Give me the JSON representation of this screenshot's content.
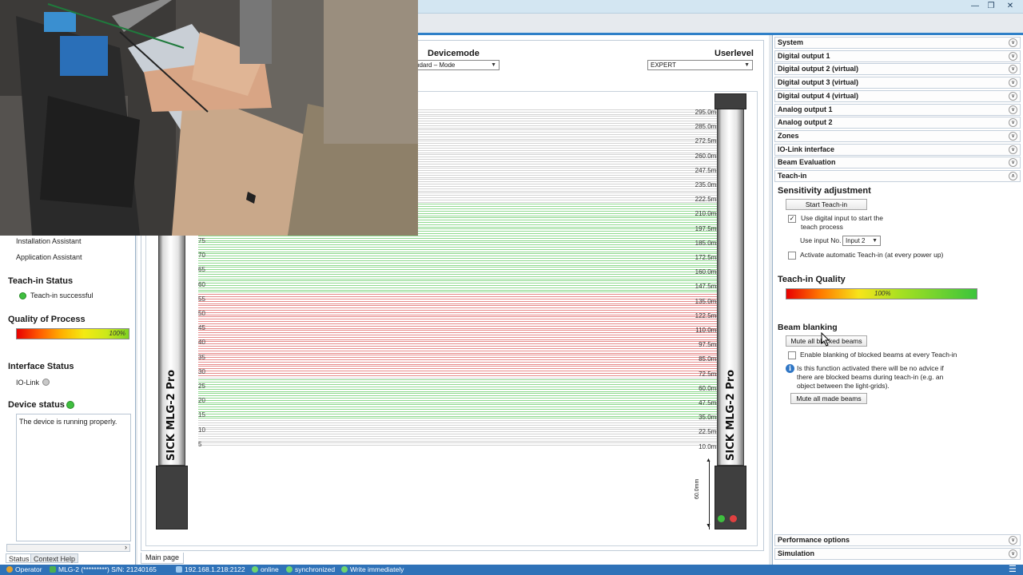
{
  "window": {
    "min_icon": "minimize-icon",
    "max_icon": "restore-icon",
    "close_icon": "close-icon"
  },
  "left_panel": {
    "links": [
      "Installation Assistant",
      "Application Assistant"
    ],
    "teachin_status": {
      "title": "Teach-in Status",
      "value": "Teach-in successful",
      "color": "#3fbf3f"
    },
    "quality": {
      "title": "Quality of Process",
      "value": "100%"
    },
    "interface": {
      "title": "Interface Status",
      "iolink_label": "IO-Link",
      "color": "#c8c8c8"
    },
    "device_status": {
      "title": "Device status",
      "message": "The device is running properly.",
      "color": "#3fbf3f"
    },
    "tabs": [
      "Status",
      "Context Help"
    ]
  },
  "center": {
    "devicemode": {
      "label": "Devicemode",
      "value": "Standard – Mode"
    },
    "userlevel": {
      "label": "Userlevel",
      "value": "EXPERT"
    },
    "brand_left": "SICK MLG-2 Pro",
    "brand_right": "SICK MLG-2 Pro",
    "dimension_label": "60.0mm",
    "beam_numbers": [
      "75",
      "70",
      "65",
      "60",
      "55",
      "50",
      "45",
      "40",
      "35",
      "30",
      "25",
      "20",
      "15",
      "10",
      "5"
    ],
    "mm_labels": [
      "295.0mm",
      "285.0mm",
      "272.5mm",
      "260.0mm",
      "247.5mm",
      "235.0mm",
      "222.5mm",
      "210.0mm",
      "197.5mm",
      "185.0mm",
      "172.5mm",
      "160.0mm",
      "147.5mm",
      "135.0mm",
      "122.5mm",
      "110.0mm",
      "97.5mm",
      "85.0mm",
      "72.5mm",
      "60.0mm",
      "47.5mm",
      "35.0mm",
      "22.5mm",
      "10.0mm"
    ],
    "tab_label": "Main page",
    "beam_colors": {
      "clear": "#8fd98f",
      "blocked": "#e68a8a",
      "inactive": "#d4d4d4"
    }
  },
  "right_panel": {
    "sections": [
      "System",
      "Digital output 1",
      "Digital output 2 (virtual)",
      "Digital output 3 (virtual)",
      "Digital output 4 (virtual)",
      "Analog output 1",
      "Analog output 2",
      "Zones",
      "IO-Link interface",
      "Beam Evaluation",
      "Teach-in"
    ],
    "sensitivity": {
      "title": "Sensitivity adjustment",
      "start_button": "Start Teach-in",
      "use_digital_input": "Use digital input to start the teach process",
      "use_input_no_label": "Use input No.",
      "input_value": "Input 2",
      "auto_teachin": "Activate automatic Teach-in (at every power up)"
    },
    "teachin_quality": {
      "title": "Teach-in Quality",
      "value": "100%"
    },
    "beam_blanking": {
      "title": "Beam blanking",
      "mute_blocked_button": "Mute all blocked beams",
      "enable_blanking": "Enable blanking of blocked beams at every Teach-in",
      "info_text": "Is this function activated there will be no advice if there are blocked beams during teach-in (e.g. an object between the light-grids).",
      "mute_made_button": "Mute all made beams"
    },
    "bottom_sections": [
      "Performance options",
      "Simulation"
    ]
  },
  "status_bar": {
    "user": "Operator",
    "device": "MLG-2 (*********) S/N: 21240165",
    "address": "192.168.1.218:2122",
    "online": "online",
    "sync": "synchronized",
    "write": "Write immediately"
  }
}
